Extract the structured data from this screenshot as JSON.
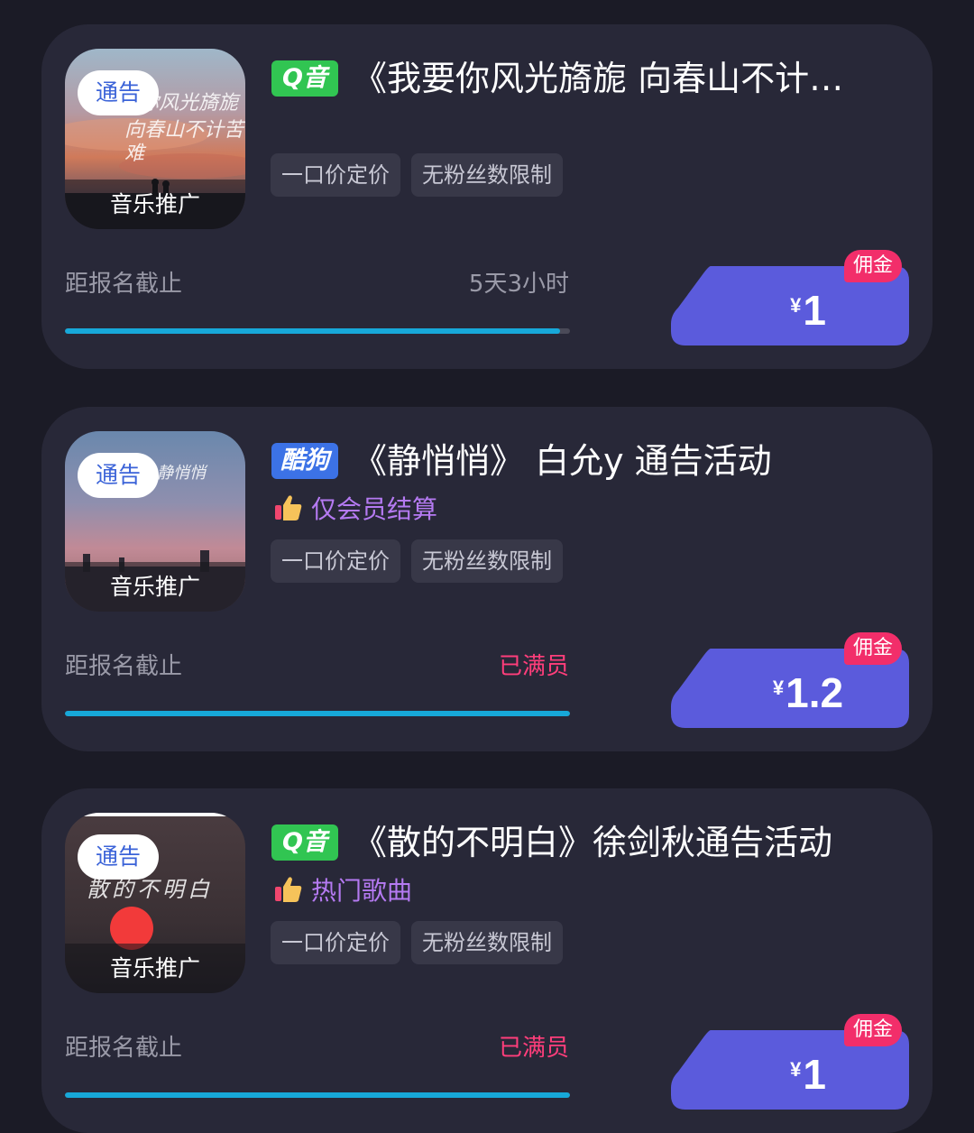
{
  "cards": [
    {
      "cover_tag": "通告",
      "cover_strip": "音乐推广",
      "cover_script": [
        "我要你风光旖旎",
        "向春山不计苦难"
      ],
      "platform": "Q音",
      "title": "《我要你风光旖旎 向春山不计…",
      "perk": "",
      "chips": [
        "一口价定价",
        "无粉丝数限制"
      ],
      "deadline_label": "距报名截止",
      "deadline_value": "5天3小时",
      "progress": 0.98,
      "price_currency": "¥",
      "price_amount": "1",
      "commission_label": "佣金"
    },
    {
      "cover_tag": "通告",
      "cover_strip": "音乐推广",
      "cover_script": [
        "静悄悄"
      ],
      "platform": "酷狗",
      "title": "《静悄悄》 白允y 通告活动",
      "perk": "仅会员结算",
      "chips": [
        "一口价定价",
        "无粉丝数限制"
      ],
      "deadline_label": "距报名截止",
      "deadline_value": "已满员",
      "progress": 1,
      "price_currency": "¥",
      "price_amount": "1.2",
      "commission_label": "佣金"
    },
    {
      "cover_tag": "通告",
      "cover_strip": "音乐推广",
      "cover_script": [
        "散的不明白"
      ],
      "platform": "Q音",
      "title": "《散的不明白》徐剑秋通告活动",
      "perk": "热门歌曲",
      "chips": [
        "一口价定价",
        "无粉丝数限制"
      ],
      "deadline_label": "距报名截止",
      "deadline_value": "已满员",
      "progress": 1,
      "price_currency": "¥",
      "price_amount": "1",
      "commission_label": "佣金"
    }
  ],
  "colors": {
    "background": "#1b1b26",
    "card": "#282838",
    "accent_button": "#5b5bdc",
    "commission_badge": "#f22e6a",
    "full_status": "#ff3e7b",
    "progress_fill": "#17a8d9",
    "perk_text": "#b57af2",
    "qq_music": "#31c552",
    "kugou": "#3c72e6"
  },
  "icons": {
    "perk": "thumbs-up-icon"
  }
}
